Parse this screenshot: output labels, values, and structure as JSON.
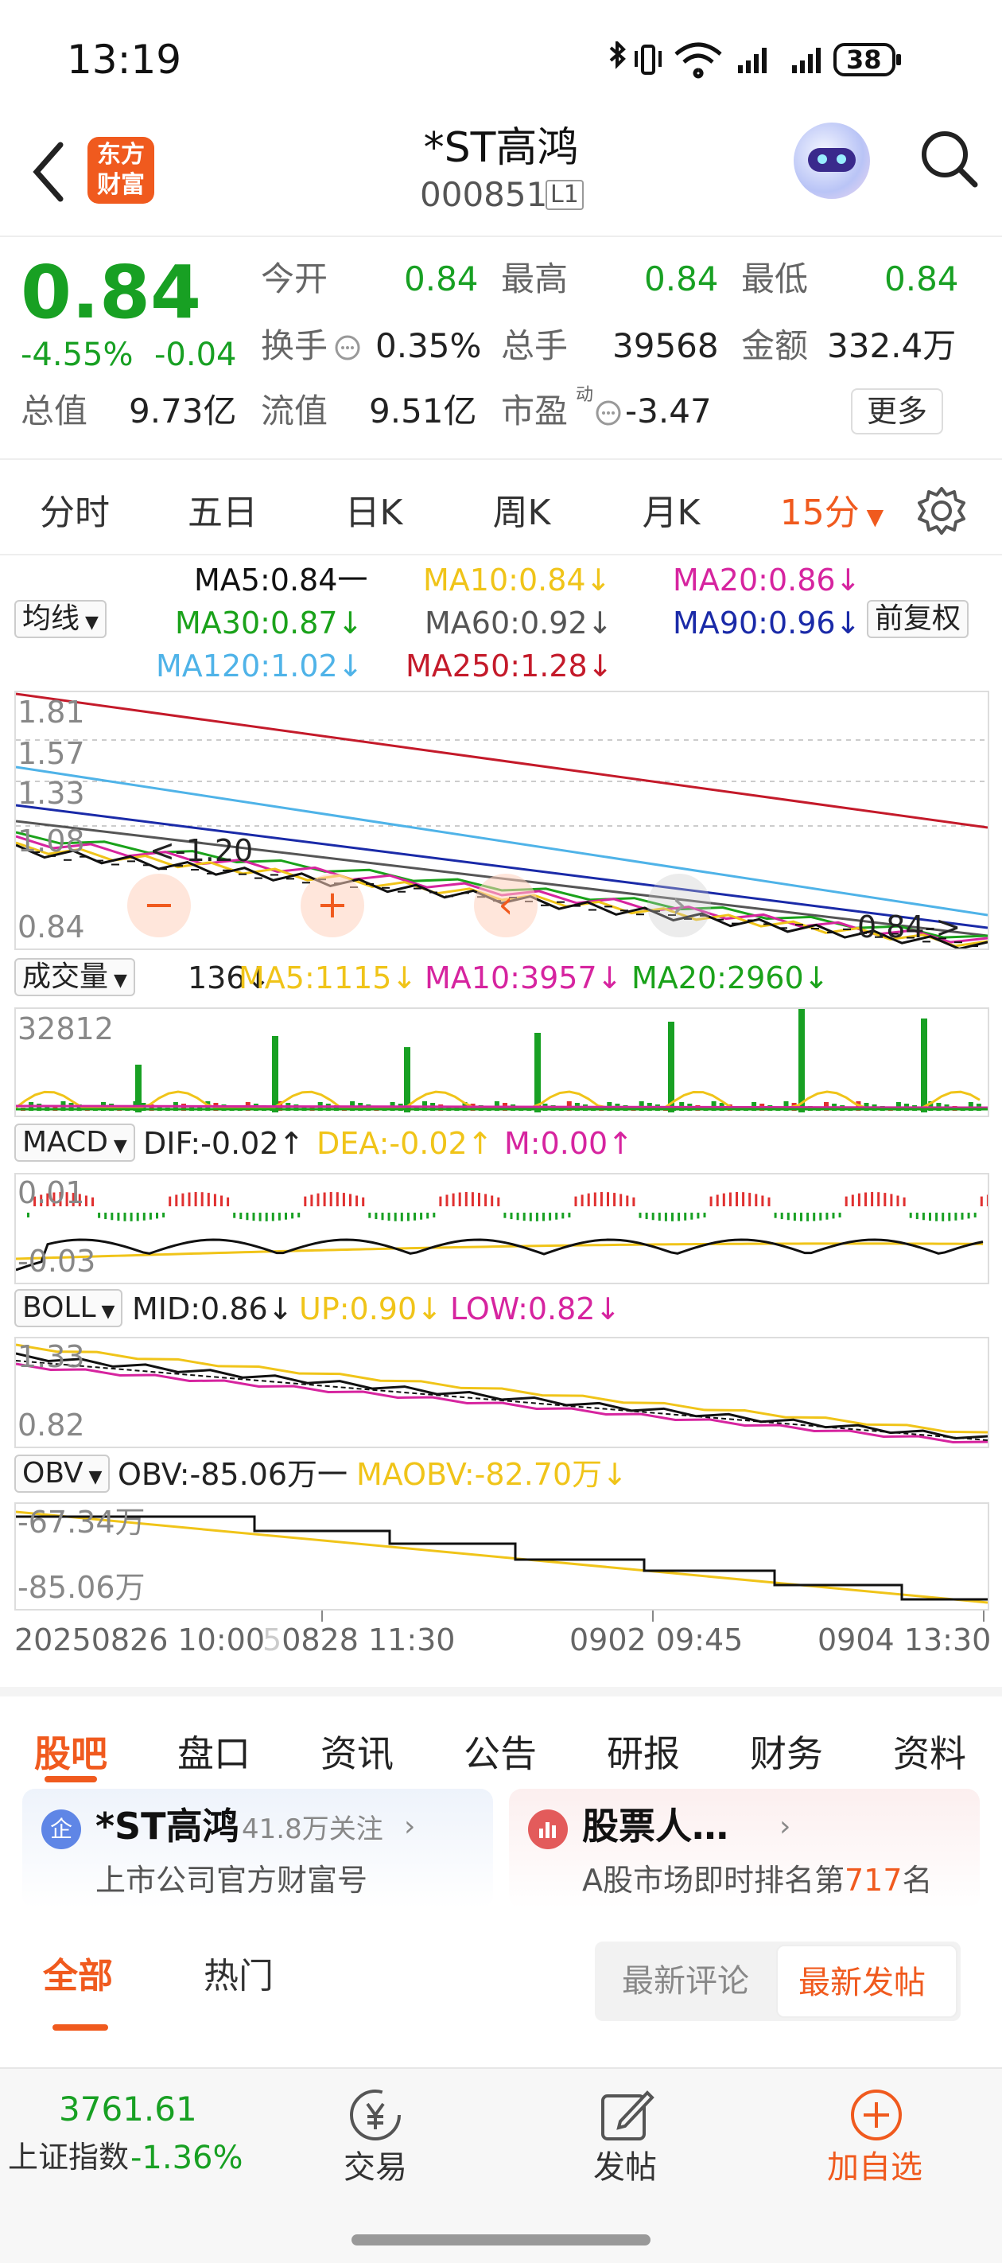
{
  "status": {
    "time": "13:19",
    "battery": "38"
  },
  "nav": {
    "logo_line1": "东方",
    "logo_line2": "财富",
    "title": "*ST高鸿",
    "code": "000851",
    "level": "L1"
  },
  "quote": {
    "price": "0.84",
    "change_pct": "-4.55%",
    "change": "-0.04",
    "open_label": "今开",
    "open": "0.84",
    "high_label": "最高",
    "high": "0.84",
    "low_label": "最低",
    "low": "0.84",
    "turnover_label": "换手",
    "turnover": "0.35%",
    "volume_label": "总手",
    "volume": "39568",
    "amount_label": "金额",
    "amount": "332.4万",
    "mktcap_label": "总值",
    "mktcap": "9.73亿",
    "float_label": "流值",
    "float": "9.51亿",
    "pe_label": "市盈",
    "pe_sup": "动",
    "pe": "-3.47",
    "more": "更多"
  },
  "ktabs": [
    "分时",
    "五日",
    "日K",
    "周K",
    "月K"
  ],
  "ktab_active": "15分",
  "chart": {
    "ma_selector": "均线",
    "adjust": "前复权",
    "ma": {
      "ma5": "MA5:0.84一",
      "ma10": "MA10:0.84↓",
      "ma20": "MA20:0.86↓",
      "ma30": "MA30:0.87↓",
      "ma60": "MA60:0.92↓",
      "ma90": "MA90:0.96↓",
      "ma120": "MA120:1.02↓",
      "ma250": "MA250:1.28↓"
    },
    "price_axis": [
      "1.81",
      "1.57",
      "1.33",
      "1.08",
      "0.84"
    ],
    "price_hl_left": "1.20",
    "price_hl_right": "0.84",
    "vol_selector": "成交量",
    "vol_val": "136↓",
    "vol_ma5": "MA5:1115↓",
    "vol_ma10": "MA10:3957↓",
    "vol_ma20": "MA20:2960↓",
    "vol_max": "32812",
    "macd_selector": "MACD",
    "dif": "DIF:-0.02↑",
    "dea": "DEA:-0.02↑",
    "m": "M:0.00↑",
    "macd_top": "0.01",
    "macd_bot": "-0.03",
    "boll_selector": "BOLL",
    "mid": "MID:0.86↓",
    "up": "UP:0.90↓",
    "low": "LOW:0.82↓",
    "boll_top": "1.33",
    "boll_bot": "0.82",
    "obv_selector": "OBV",
    "obv": "OBV:-85.06万一",
    "maobv": "MAOBV:-82.70万↓",
    "obv_top": "-67.34万",
    "obv_bot": "-85.06万",
    "time_labels": [
      "20250826 10:00",
      "0828 11:30",
      "0902 09:45",
      "0904 13:30"
    ],
    "colors": {
      "ma5": "#111111",
      "ma10": "#f0c419",
      "ma20": "#d6249f",
      "ma30": "#1aa21a",
      "ma60": "#555555",
      "ma90": "#1a2aa8",
      "ma120": "#4fb3e8",
      "ma250": "#c41a2a",
      "up": "#e03030",
      "down": "#18a023"
    }
  },
  "infotabs": [
    "股吧",
    "盘口",
    "资讯",
    "公告",
    "研报",
    "财务",
    "资料"
  ],
  "cards": {
    "c1_title": "*ST高鸿",
    "c1_follow": "41.8万关注",
    "c1_sub": "上市公司官方财富号",
    "c2_title": "股票人…",
    "c2_sub_prefix": "A股市场即时排名第",
    "c2_rank": "717",
    "c2_sub_suffix": "名"
  },
  "subtabs": {
    "all": "全部",
    "hot": "热门",
    "latest_comment": "最新评论",
    "latest_post": "最新发帖"
  },
  "bottom": {
    "index_value": "3761.61",
    "index_name": "上证指数",
    "index_change": "-1.36%",
    "trade": "交易",
    "post": "发帖",
    "add": "加自选"
  }
}
